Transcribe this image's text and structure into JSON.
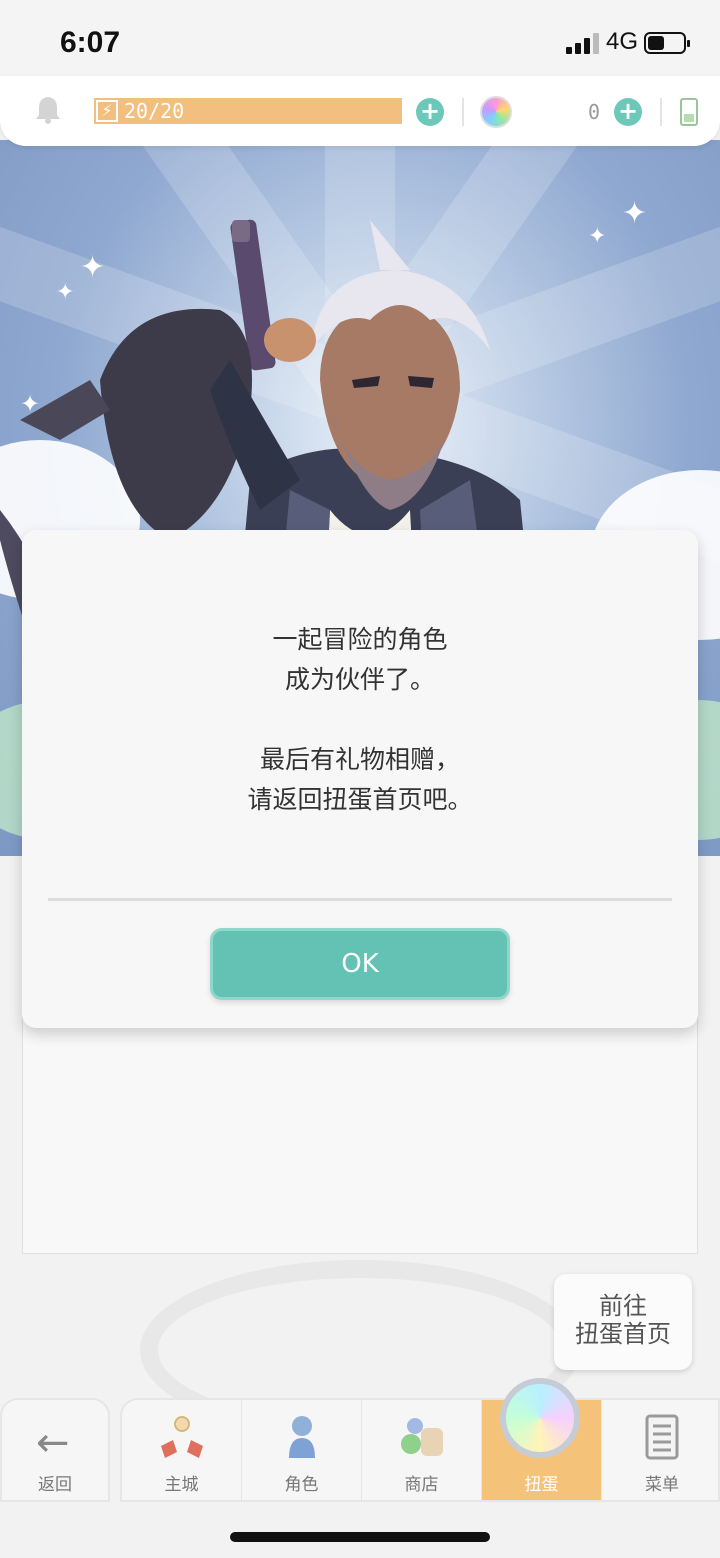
{
  "status_bar": {
    "time": "6:07",
    "network": "4G"
  },
  "resources": {
    "stamina": "20/20",
    "gems": "0",
    "accent_color": "#6cc8b8",
    "stamina_color": "#f2bf7e",
    "stamina_fill": 1.0
  },
  "dialog": {
    "line1": "一起冒险的角色",
    "line2": "成为伙伴了。",
    "line3": "最后有礼物相赠，",
    "line4": "请返回扭蛋首页吧。",
    "ok_label": "OK",
    "button_color": "#63c2b3"
  },
  "goto": {
    "line1": "前往",
    "line2": "扭蛋首页"
  },
  "nav": {
    "back": "返回",
    "items": [
      {
        "label": "主城",
        "icon": "castle-icon"
      },
      {
        "label": "角色",
        "icon": "character-icon"
      },
      {
        "label": "商店",
        "icon": "shop-icon"
      },
      {
        "label": "扭蛋",
        "icon": "gacha-icon",
        "active": true
      },
      {
        "label": "菜单",
        "icon": "menu-icon"
      }
    ],
    "active_color": "#f5c27a"
  }
}
